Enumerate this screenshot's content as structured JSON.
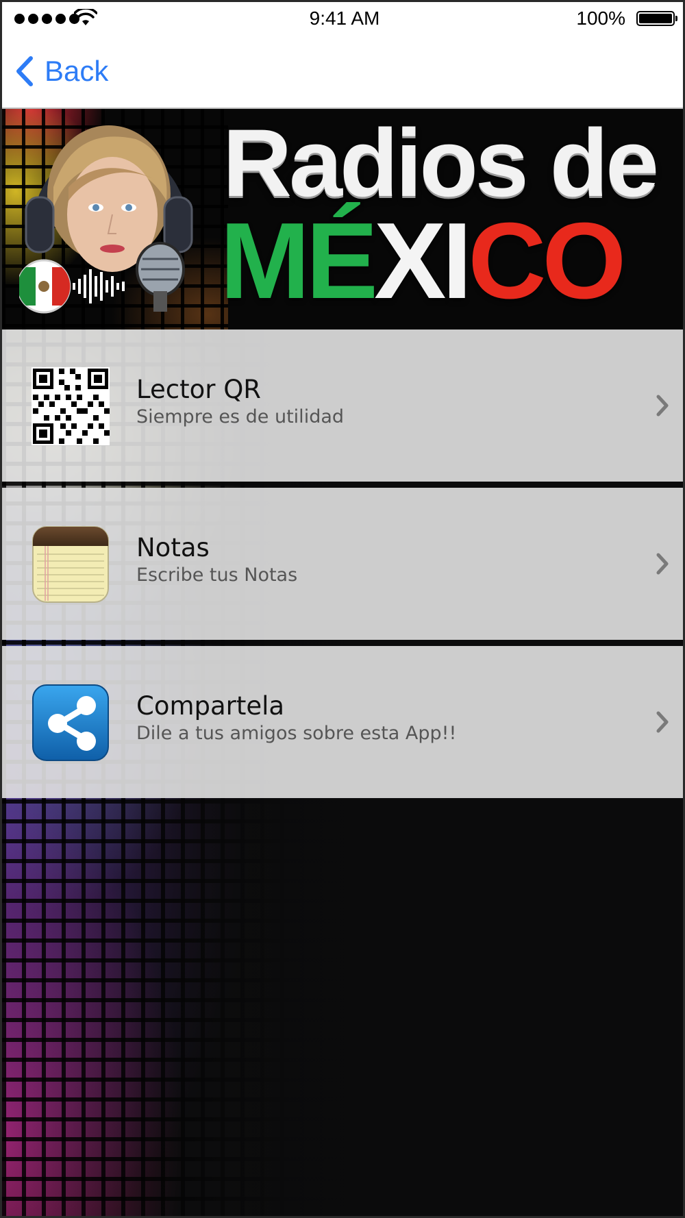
{
  "status_bar": {
    "time": "9:41 AM",
    "battery_percent": "100%",
    "signal_bars": 5,
    "battery_level": 1.0,
    "icons": [
      "signal-dots-icon",
      "wifi-icon",
      "battery-icon"
    ]
  },
  "nav": {
    "back_label": "Back",
    "back_icon": "chevron-left-icon",
    "accent_color": "#2d7cf6"
  },
  "banner": {
    "title_line1": "Radios de",
    "title_line2_parts": [
      "MÉ",
      "XI",
      "CO"
    ],
    "colors": {
      "green": "#22b14c",
      "white": "#f4f4f4",
      "red": "#e8291c"
    },
    "icons": [
      "woman-with-headphones-image",
      "mexico-flag-icon",
      "microphone-icon",
      "sound-wave-icon"
    ]
  },
  "menu": {
    "items": [
      {
        "title": "Lector QR",
        "subtitle": "Siempre es de utilidad",
        "icon": "qr-code-icon"
      },
      {
        "title": "Notas",
        "subtitle": "Escribe tus Notas",
        "icon": "notepad-icon"
      },
      {
        "title": "Compartela",
        "subtitle": "Dile a tus amigos sobre esta App!!",
        "icon": "share-icon"
      }
    ],
    "chevron_icon": "chevron-right-icon"
  }
}
